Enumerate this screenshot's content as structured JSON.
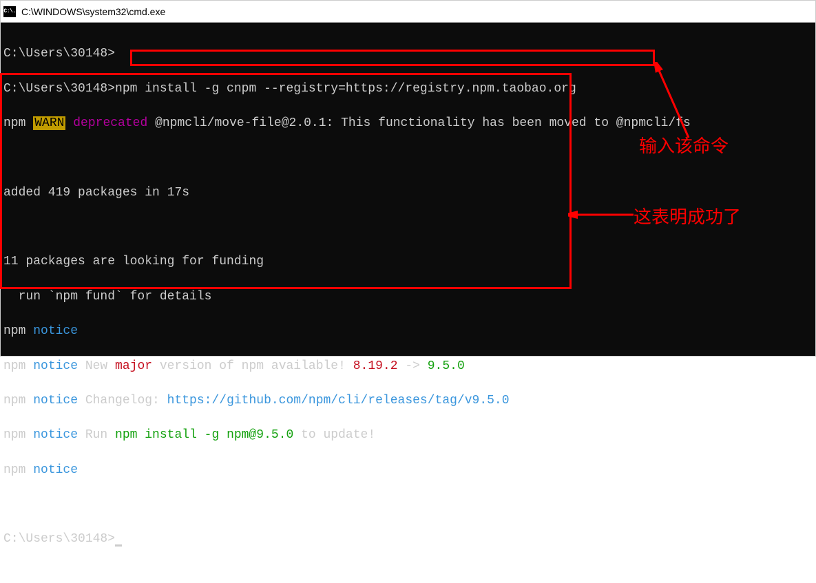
{
  "window": {
    "title": "C:\\WINDOWS\\system32\\cmd.exe",
    "icon_label": "C:\\."
  },
  "prompt": "C:\\Users\\30148>",
  "command": "npm install -g cnpm --registry=https://registry.npm.taobao.org",
  "warn_line": {
    "npm": "npm",
    "warn": "WARN",
    "deprecated": "deprecated",
    "rest": " @npmcli/move-file@2.0.1: This functionality has been moved to @npmcli/fs"
  },
  "added_line": "added 419 packages in 17s",
  "funding_line1": "11 packages are looking for funding",
  "funding_line2": "  run `npm fund` for details",
  "notice": {
    "npm": "npm",
    "notice": "notice",
    "new_major": " New ",
    "major": "major",
    "available": " version of npm available! ",
    "old_version": "8.19.2",
    "arrow": " -> ",
    "new_version": "9.5.0",
    "changelog_label": " Changelog: ",
    "changelog_url": "https://github.com/npm/cli/releases/tag/v9.5.0",
    "run_label": " Run ",
    "run_cmd": "npm install -g npm@9.5.0",
    "to_update": " to update!"
  },
  "annotations": {
    "label1": "输入该命令",
    "label2": "这表明成功了"
  }
}
